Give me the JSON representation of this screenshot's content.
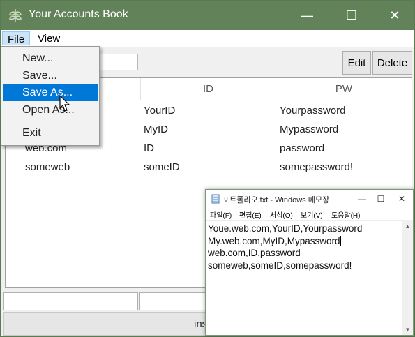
{
  "app": {
    "title": "Your Accounts Book",
    "minimize_symbol": "—",
    "maximize_symbol": "☐",
    "close_symbol": "✕",
    "titlebar_color": "#62825a"
  },
  "menubar": {
    "file": "File",
    "view": "View"
  },
  "toolbar": {
    "search_value": "",
    "edit": "Edit",
    "delete": "Delete"
  },
  "table": {
    "headers": [
      "",
      "ID",
      "PW"
    ],
    "rows": [
      [
        "",
        "YourID",
        "Yourpassword"
      ],
      [
        "",
        "MyID",
        "Mypassword"
      ],
      [
        "web.com",
        "ID",
        "password"
      ],
      [
        "someweb",
        "someID",
        "somepassword!"
      ]
    ]
  },
  "file_menu": {
    "items": [
      "New...",
      "Save...",
      "Save As...",
      "Open As...",
      "Exit"
    ],
    "highlighted": "Save As...",
    "highlight_color": "#0078d7"
  },
  "bottom_bar": {
    "label": "ins"
  },
  "notepad": {
    "title": "포트폴리오.txt - Windows 메모장",
    "menus": [
      "파일(F)",
      "편집(E)",
      "서식(O)",
      "보기(V)",
      "도움말(H)"
    ],
    "lines": [
      "Youe.web.com,YourID,Yourpassword",
      "My.web.com,MyID,Mypassword",
      "web.com,ID,password",
      "someweb,someID,somepassword!"
    ],
    "minimize_symbol": "—",
    "maximize_symbol": "☐",
    "close_symbol": "✕",
    "scroll_up": "▲",
    "scroll_down": "▼"
  }
}
